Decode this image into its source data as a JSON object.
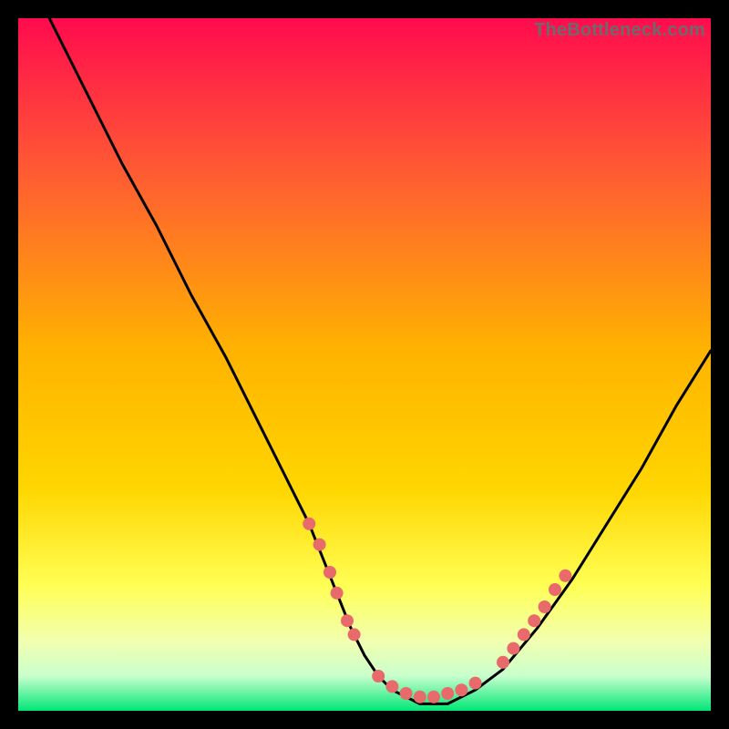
{
  "watermark": "TheBottleneck.com",
  "colors": {
    "gradient_top": "#ff0b4e",
    "gradient_mid_upper": "#ff6a2a",
    "gradient_mid": "#ffd600",
    "gradient_mid_lower": "#ffff66",
    "gradient_pale": "#f2ffcc",
    "gradient_green": "#00e676",
    "curve": "#000000",
    "markers": "#e86a6a"
  },
  "chart_data": {
    "type": "line",
    "title": "",
    "xlabel": "",
    "ylabel": "",
    "xlim": [
      0,
      100
    ],
    "ylim": [
      0,
      100
    ],
    "series": [
      {
        "name": "bottleneck-curve",
        "x": [
          0,
          2,
          5,
          10,
          15,
          20,
          25,
          30,
          35,
          38,
          40,
          42,
          44,
          46,
          48,
          50,
          52,
          54,
          56,
          58,
          60,
          62,
          64,
          66,
          70,
          75,
          80,
          85,
          90,
          95,
          100
        ],
        "y": [
          109,
          105,
          99,
          89,
          79,
          70,
          60,
          51,
          41,
          35,
          31,
          27,
          22,
          17,
          12,
          8,
          5,
          3,
          2,
          1,
          1,
          1,
          2,
          3,
          6,
          12,
          19,
          27,
          35,
          44,
          52
        ]
      }
    ],
    "markers": {
      "name": "highlight-points",
      "left_cluster": {
        "x": [
          42,
          43.5,
          45,
          46,
          47.5,
          48.5
        ],
        "y": [
          27,
          24,
          20,
          17,
          13,
          11
        ]
      },
      "bottom_cluster": {
        "x": [
          52,
          54,
          56,
          58,
          60,
          62,
          64,
          66
        ],
        "y": [
          5,
          3.5,
          2.5,
          2,
          2,
          2.5,
          3,
          4
        ]
      },
      "right_cluster": {
        "x": [
          70,
          71.5,
          73,
          74.5,
          76,
          77.5,
          79
        ],
        "y": [
          7,
          9,
          11,
          13,
          15,
          17.5,
          19.5
        ]
      }
    }
  }
}
